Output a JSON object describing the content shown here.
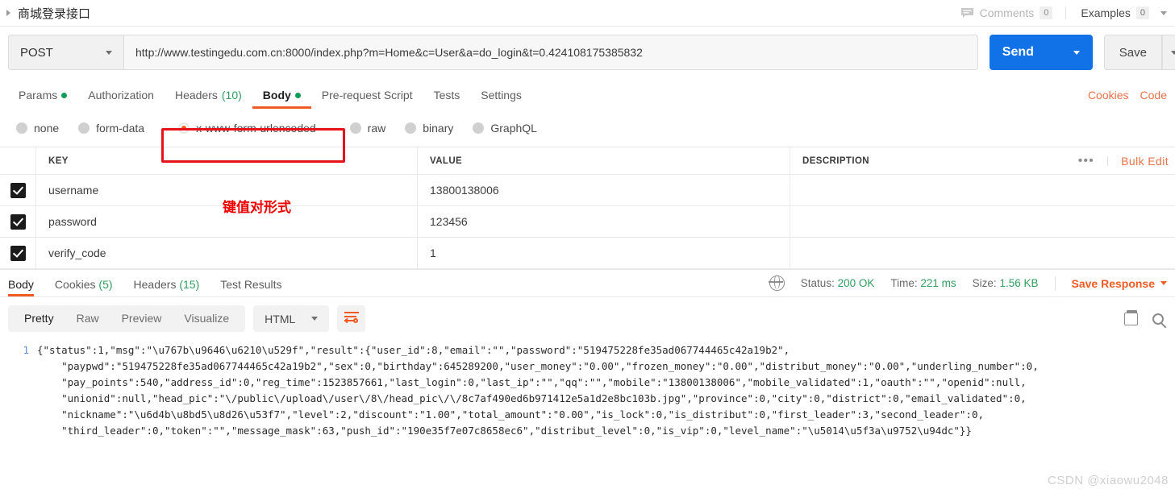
{
  "titlebar": {
    "request_name": "商城登录接口",
    "comments_label": "Comments",
    "comments_count": "0",
    "examples_label": "Examples",
    "examples_count": "0"
  },
  "urlbar": {
    "method": "POST",
    "url": "http://www.testingedu.com.cn:8000/index.php?m=Home&c=User&a=do_login&t=0.424108175385832",
    "send_label": "Send",
    "save_label": "Save"
  },
  "request_tabs": [
    {
      "label": "Params",
      "dot": true,
      "count": "",
      "active": false
    },
    {
      "label": "Authorization",
      "dot": false,
      "count": "",
      "active": false
    },
    {
      "label": "Headers",
      "dot": false,
      "count": "(10)",
      "active": false
    },
    {
      "label": "Body",
      "dot": true,
      "count": "",
      "active": true
    },
    {
      "label": "Pre-request Script",
      "dot": false,
      "count": "",
      "active": false
    },
    {
      "label": "Tests",
      "dot": false,
      "count": "",
      "active": false
    },
    {
      "label": "Settings",
      "dot": false,
      "count": "",
      "active": false
    }
  ],
  "request_tabs_right": [
    "Cookies",
    "Code"
  ],
  "body_types": [
    {
      "label": "none",
      "selected": false
    },
    {
      "label": "form-data",
      "selected": false
    },
    {
      "label": "x-www-form-urlencoded",
      "selected": true
    },
    {
      "label": "raw",
      "selected": false
    },
    {
      "label": "binary",
      "selected": false
    },
    {
      "label": "GraphQL",
      "selected": false
    }
  ],
  "kv_table": {
    "headers": {
      "key": "KEY",
      "value": "VALUE",
      "description": "DESCRIPTION"
    },
    "more_label": "•••",
    "bulk_edit_label": "Bulk Edit",
    "rows": [
      {
        "checked": true,
        "key": "username",
        "value": "13800138006",
        "description": ""
      },
      {
        "checked": true,
        "key": "password",
        "value": "123456",
        "description": ""
      },
      {
        "checked": true,
        "key": "verify_code",
        "value": "1",
        "description": ""
      }
    ]
  },
  "annotations": {
    "kv_note": "键值对形式",
    "box_color": "#e8121b",
    "text_color": "#ee0000"
  },
  "response_tabs": [
    {
      "label": "Body",
      "count": "",
      "active": true
    },
    {
      "label": "Cookies",
      "count": "(5)",
      "active": false
    },
    {
      "label": "Headers",
      "count": "(15)",
      "active": false
    },
    {
      "label": "Test Results",
      "count": "",
      "active": false
    }
  ],
  "response_meta": {
    "status_label": "Status:",
    "status_value": "200 OK",
    "time_label": "Time:",
    "time_value": "221 ms",
    "size_label": "Size:",
    "size_value": "1.56 KB",
    "save_response_label": "Save Response"
  },
  "viewer": {
    "modes": [
      {
        "label": "Pretty",
        "active": true
      },
      {
        "label": "Raw",
        "active": false
      },
      {
        "label": "Preview",
        "active": false
      },
      {
        "label": "Visualize",
        "active": false
      }
    ],
    "format": "HTML",
    "line_number": "1"
  },
  "response_body": "{\"status\":1,\"msg\":\"\\u767b\\u9646\\u6210\\u529f\",\"result\":{\"user_id\":8,\"email\":\"\",\"password\":\"519475228fe35ad067744465c42a19b2\",\n    \"paypwd\":\"519475228fe35ad067744465c42a19b2\",\"sex\":0,\"birthday\":645289200,\"user_money\":\"0.00\",\"frozen_money\":\"0.00\",\"distribut_money\":\"0.00\",\"underling_number\":0,\n    \"pay_points\":540,\"address_id\":0,\"reg_time\":1523857661,\"last_login\":0,\"last_ip\":\"\",\"qq\":\"\",\"mobile\":\"13800138006\",\"mobile_validated\":1,\"oauth\":\"\",\"openid\":null,\n    \"unionid\":null,\"head_pic\":\"\\/public\\/upload\\/user\\/8\\/head_pic\\/\\/8c7af490ed6b971412e5a1d2e8bc103b.jpg\",\"province\":0,\"city\":0,\"district\":0,\"email_validated\":0,\n    \"nickname\":\"\\u6d4b\\u8bd5\\u8d26\\u53f7\",\"level\":2,\"discount\":\"1.00\",\"total_amount\":\"0.00\",\"is_lock\":0,\"is_distribut\":0,\"first_leader\":3,\"second_leader\":0,\n    \"third_leader\":0,\"token\":\"\",\"message_mask\":63,\"push_id\":\"190e35f7e07c8658ec6\",\"distribut_level\":0,\"is_vip\":0,\"level_name\":\"\\u5014\\u5f3a\\u9752\\u94dc\"}}",
  "watermark": "CSDN @xiaowu2048"
}
